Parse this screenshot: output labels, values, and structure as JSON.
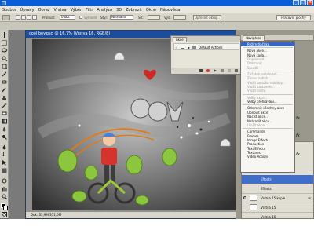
{
  "app": {
    "menu": [
      "Soubor",
      "Úpravy",
      "Obraz",
      "Vrstva",
      "Výběr",
      "Filtr",
      "Analýza",
      "3D",
      "Zobrazit",
      "Okno",
      "Nápověda"
    ],
    "workspace_button": "Pracovní plochy"
  },
  "options_bar": {
    "feather_label": "Prolnutí:",
    "feather_value": "0 obr.",
    "antialias_label": "Vyhladit",
    "style_label": "Styl:",
    "style_value": "Normální",
    "width_label": "Šíř.:",
    "height_label": "Výš.:",
    "refine_button": "Upřesnit okraj..."
  },
  "document": {
    "title": "cool boy.psd @ 16,7% (Vrstva 16, RGB/8)",
    "status": "Dok: 35,9M/351,0M"
  },
  "actions_panel": {
    "tab": "Akce",
    "set_name": "Default Actions"
  },
  "navigator_panel": {
    "tab": "Navigátor"
  },
  "panel_menu": {
    "items": [
      {
        "label": "Režim tlačítka",
        "state": "selected"
      },
      {
        "sep": true
      },
      {
        "label": "Nová akce...",
        "state": "normal"
      },
      {
        "label": "Nová sada...",
        "state": "normal"
      },
      {
        "label": "Duplikovat",
        "state": "disabled"
      },
      {
        "label": "Odstranit",
        "state": "disabled"
      },
      {
        "label": "Spustit",
        "state": "disabled"
      },
      {
        "sep": true
      },
      {
        "label": "Začátek nahrávání",
        "state": "disabled"
      },
      {
        "label": "Znovu nahrát...",
        "state": "disabled"
      },
      {
        "label": "Vložit položku nabídky...",
        "state": "disabled"
      },
      {
        "label": "Vložit zastavení...",
        "state": "disabled"
      },
      {
        "label": "Vložit cestu",
        "state": "disabled"
      },
      {
        "sep": true
      },
      {
        "label": "Volby akce...",
        "state": "disabled"
      },
      {
        "label": "Volby přehrávání...",
        "state": "normal"
      },
      {
        "sep": true
      },
      {
        "label": "Odstranit všechny akce",
        "state": "normal"
      },
      {
        "label": "Obnovit akce",
        "state": "normal"
      },
      {
        "label": "Načíst akce...",
        "state": "normal"
      },
      {
        "label": "Nahradit akce...",
        "state": "normal"
      },
      {
        "label": "Uložit akce...",
        "state": "disabled"
      },
      {
        "sep": true
      },
      {
        "label": "Commands",
        "state": "normal"
      },
      {
        "label": "Frames",
        "state": "normal"
      },
      {
        "label": "Image Effects",
        "state": "normal"
      },
      {
        "label": "Production",
        "state": "normal"
      },
      {
        "label": "Text Effects",
        "state": "normal"
      },
      {
        "label": "Textures",
        "state": "normal"
      },
      {
        "label": "Video Actions",
        "state": "normal"
      }
    ]
  },
  "layers": {
    "items": [
      {
        "label": "Effects",
        "selected": true
      },
      {
        "label": "Effects",
        "selected": false
      },
      {
        "label": "Vrstva 15 kopie",
        "selected": false
      },
      {
        "label": "Vrstva 15",
        "selected": false
      },
      {
        "label": "Vrstva 16",
        "selected": false
      }
    ],
    "fx": "fx"
  },
  "colors": {
    "title_blue": "#0a5dd6",
    "doc_title_blue": "#1b4d9c",
    "menu_highlight": "#3466c6",
    "close_red": "#d8492c"
  }
}
